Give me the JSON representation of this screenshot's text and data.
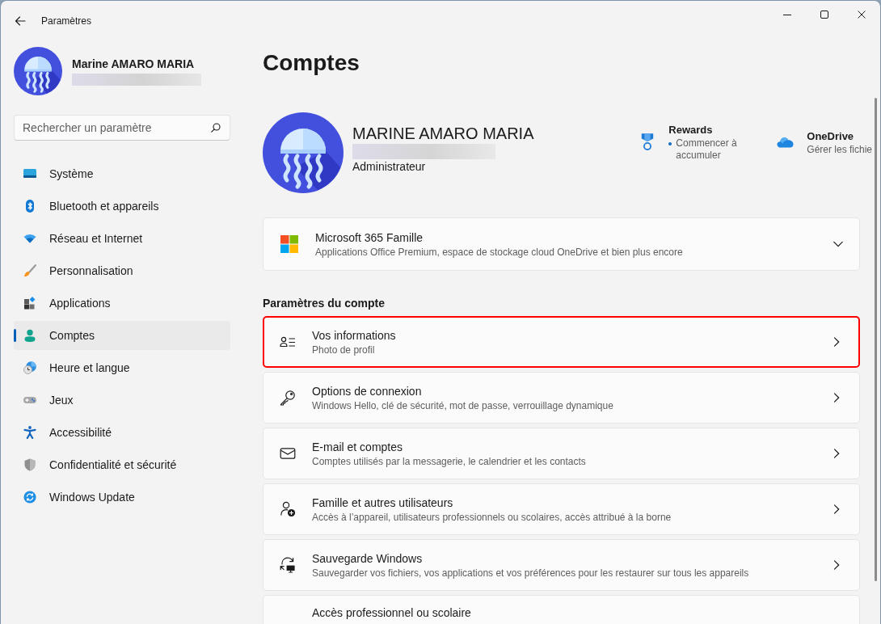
{
  "window": {
    "title": "Paramètres"
  },
  "sidebar": {
    "user_name": "Marine AMARO MARIA",
    "search": {
      "placeholder": "Rechercher un paramètre"
    },
    "items": [
      {
        "label": "Système",
        "selected": false
      },
      {
        "label": "Bluetooth et appareils",
        "selected": false
      },
      {
        "label": "Réseau et Internet",
        "selected": false
      },
      {
        "label": "Personnalisation",
        "selected": false
      },
      {
        "label": "Applications",
        "selected": false
      },
      {
        "label": "Comptes",
        "selected": true
      },
      {
        "label": "Heure et langue",
        "selected": false
      },
      {
        "label": "Jeux",
        "selected": false
      },
      {
        "label": "Accessibilité",
        "selected": false
      },
      {
        "label": "Confidentialité et sécurité",
        "selected": false
      },
      {
        "label": "Windows Update",
        "selected": false
      }
    ]
  },
  "page": {
    "title": "Comptes",
    "profile": {
      "name": "MARINE AMARO MARIA",
      "role": "Administrateur"
    },
    "rewards": {
      "title": "Rewards",
      "text": "Commencer à accumuler"
    },
    "onedrive": {
      "title": "OneDrive",
      "text": "Gérer les fichie"
    },
    "subscription": {
      "title": "Microsoft 365 Famille",
      "description": "Applications Office Premium, espace de stockage cloud OneDrive et bien plus encore",
      "expanded": false
    },
    "section_title": "Paramètres du compte",
    "settings": [
      {
        "title": "Vos informations",
        "description": "Photo de profil",
        "highlighted": true
      },
      {
        "title": "Options de connexion",
        "description": "Windows Hello, clé de sécurité, mot de passe, verrouillage dynamique",
        "highlighted": false
      },
      {
        "title": "E-mail et comptes",
        "description": "Comptes utilisés par la messagerie, le calendrier et les contacts",
        "highlighted": false
      },
      {
        "title": "Famille et autres utilisateurs",
        "description": "Accès à l’appareil, utilisateurs professionnels ou scolaires, accès attribué à la borne",
        "highlighted": false
      },
      {
        "title": "Sauvegarde Windows",
        "description": "Sauvegarder vos fichiers, vos applications et vos préférences pour les restaurer sur tous les appareils",
        "highlighted": false
      },
      {
        "title": "Accès professionnel ou scolaire",
        "highlighted": false
      }
    ]
  }
}
